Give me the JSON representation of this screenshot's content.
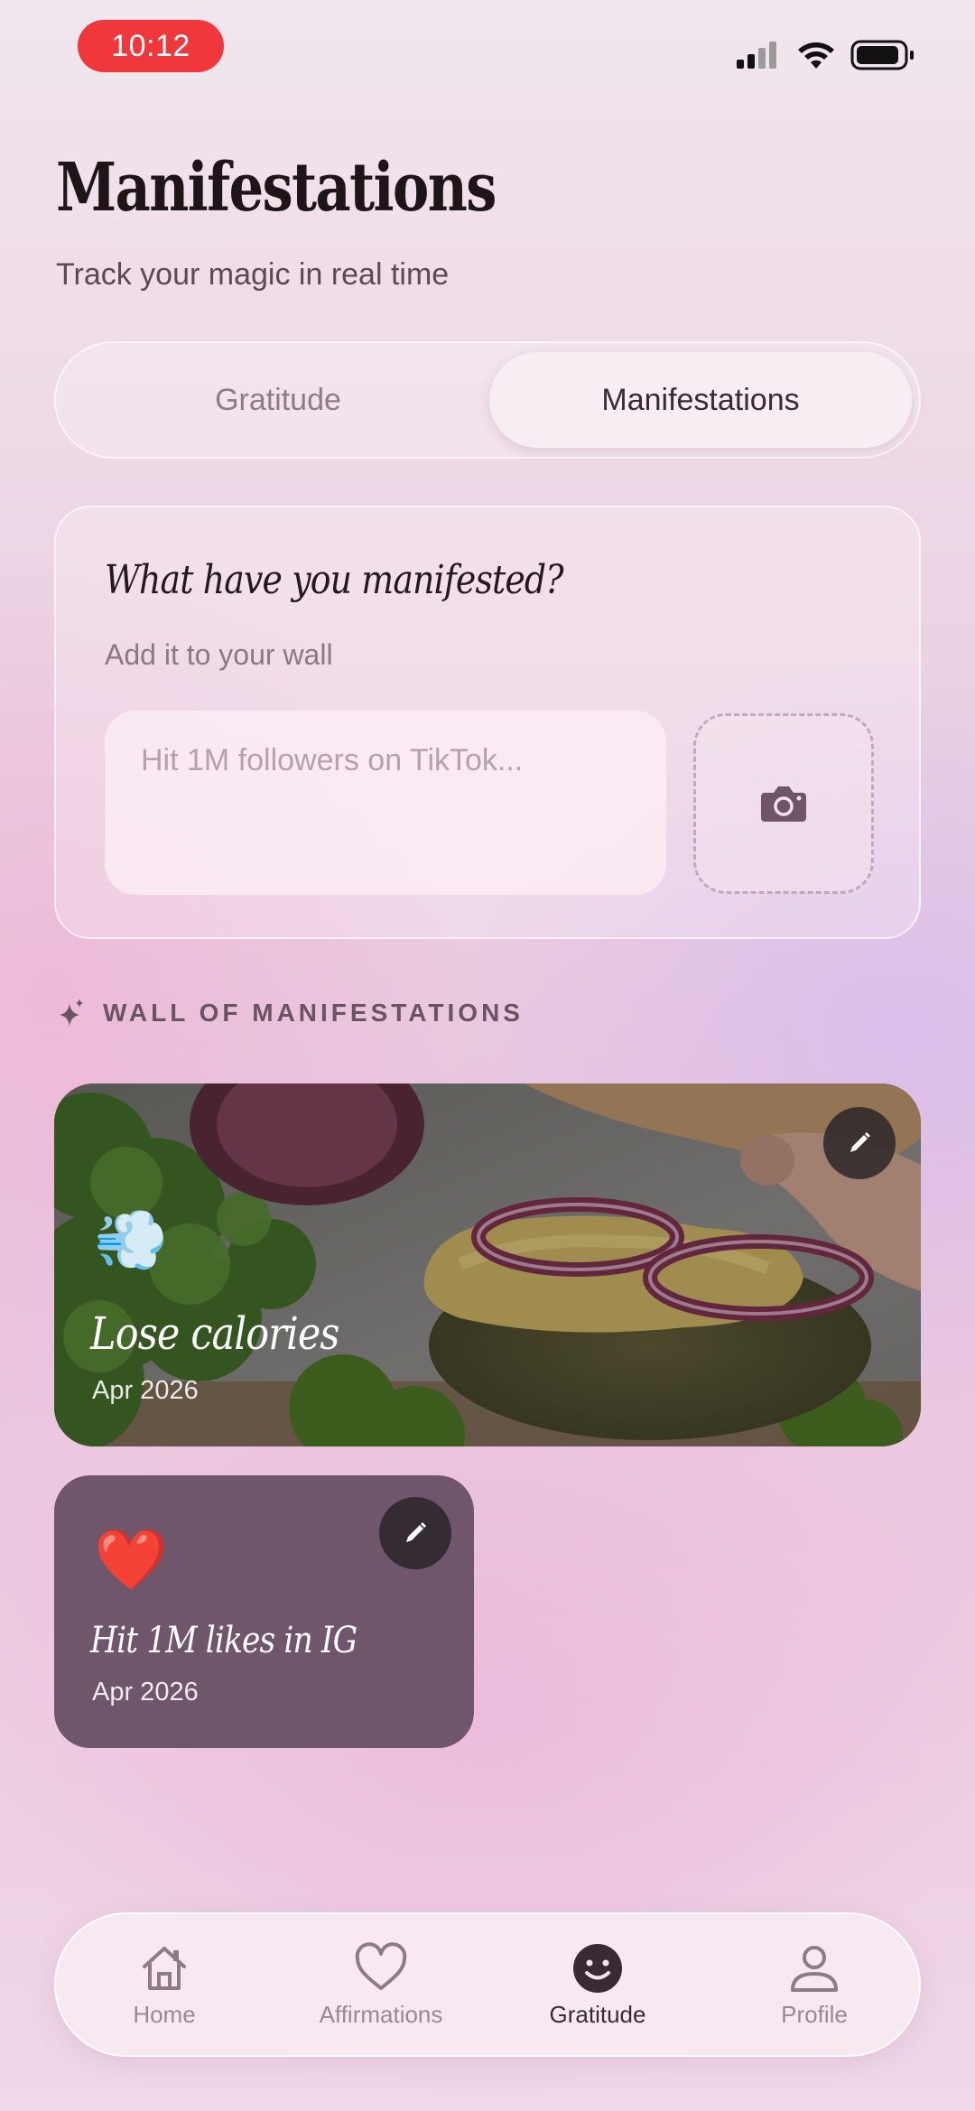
{
  "status_bar": {
    "time": "10:12"
  },
  "header": {
    "title": "Manifestations",
    "subtitle": "Track your magic in real time"
  },
  "segment": {
    "tabs": [
      {
        "label": "Gratitude",
        "active": false
      },
      {
        "label": "Manifestations",
        "active": true
      }
    ]
  },
  "compose": {
    "title": "What have you manifested?",
    "subtitle": "Add it to your wall",
    "placeholder": "Hit 1M followers on TikTok...",
    "input_value": "",
    "photo_icon": "camera-icon"
  },
  "wall": {
    "label": "WALL OF MANIFESTATIONS",
    "icon": "sparkle-icon",
    "cards": [
      {
        "emoji": "💨",
        "title": "Lose calories",
        "date": "Apr 2026",
        "has_photo": true
      },
      {
        "emoji": "❤️",
        "title": "Hit 1M likes in IG",
        "date": "Apr 2026",
        "has_photo": false
      }
    ]
  },
  "nav": {
    "items": [
      {
        "label": "Home",
        "icon": "home-icon",
        "active": false
      },
      {
        "label": "Affirmations",
        "icon": "heart-icon",
        "active": false
      },
      {
        "label": "Gratitude",
        "icon": "smiley-icon",
        "active": true
      },
      {
        "label": "Profile",
        "icon": "person-icon",
        "active": false
      }
    ]
  },
  "colors": {
    "accent_dark": "#3a2a33",
    "time_pill": "#f0373b",
    "heart_card": "#70566a"
  }
}
